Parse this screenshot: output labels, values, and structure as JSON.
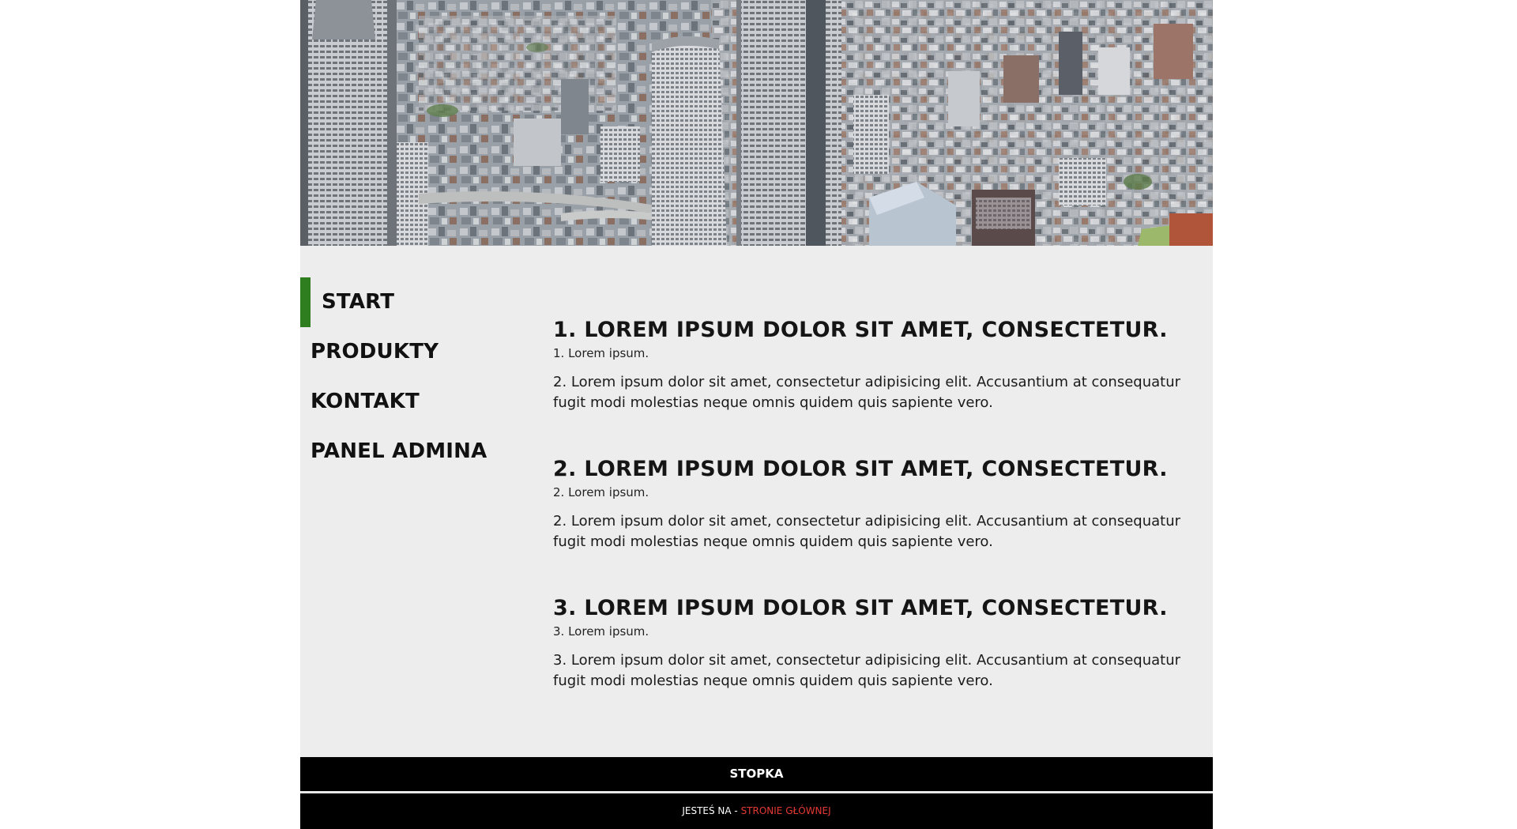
{
  "hero": {
    "image": "city-skyline-photo"
  },
  "nav": {
    "items": [
      {
        "label": "START",
        "active": true
      },
      {
        "label": "PRODUKTY",
        "active": false
      },
      {
        "label": "KONTAKT",
        "active": false
      },
      {
        "label": "PANEL ADMINA",
        "active": false
      }
    ]
  },
  "articles": [
    {
      "title": "1. LOREM IPSUM DOLOR SIT AMET, CONSECTETUR.",
      "subtitle": "1. Lorem ipsum.",
      "body": "2. Lorem ipsum dolor sit amet, consectetur adipisicing elit. Accusantium at consequatur fugit modi molestias neque omnis quidem quis sapiente vero."
    },
    {
      "title": "2. LOREM IPSUM DOLOR SIT AMET, CONSECTETUR.",
      "subtitle": "2. Lorem ipsum.",
      "body": "2. Lorem ipsum dolor sit amet, consectetur adipisicing elit. Accusantium at consequatur fugit modi molestias neque omnis quidem quis sapiente vero."
    },
    {
      "title": "3. LOREM IPSUM DOLOR SIT AMET, CONSECTETUR.",
      "subtitle": "3. Lorem ipsum.",
      "body": "3. Lorem ipsum dolor sit amet, consectetur adipisicing elit. Accusantium at consequatur fugit modi molestias neque omnis quidem quis sapiente vero."
    }
  ],
  "footer": {
    "title": "STOPKA",
    "location_prefix": "JESTEŚ NA - ",
    "location_link": "STRONIE GŁÓWNEJ"
  },
  "colors": {
    "accent": "#2e7d1e",
    "link": "#e53935",
    "content_bg": "#ededed",
    "footer_bg": "#000000"
  }
}
